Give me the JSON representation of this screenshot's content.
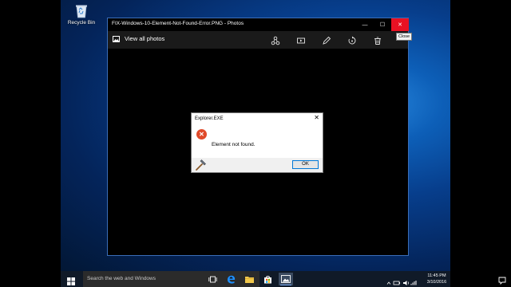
{
  "desktop": {
    "icon_label": "Recycle Bin"
  },
  "photos": {
    "title": "FIX-Windows-10-Element-Not-Found-Error.PNG - Photos",
    "minimize": "—",
    "maximize": "☐",
    "close": "✕",
    "close_tooltip": "Close",
    "view_all": "View all photos"
  },
  "dialog": {
    "title": "Explorer.EXE",
    "close": "✕",
    "error_glyph": "✕",
    "message": "Element not found.",
    "ok": "OK"
  },
  "taskbar": {
    "search_placeholder": "Search the web and Windows",
    "time": "11:45 PM",
    "date": "3/10/2016"
  },
  "colors": {
    "accent": "#0078d7",
    "close_red": "#e81123",
    "error_red": "#e04a2a"
  },
  "icons": [
    "recycle-bin-icon",
    "photo-icon",
    "share-icon",
    "slideshow-icon",
    "edit-icon",
    "rotate-icon",
    "delete-icon",
    "error-icon",
    "hammer-icon",
    "windows-icon",
    "task-view-icon",
    "edge-icon",
    "file-explorer-icon",
    "store-icon",
    "photos-icon",
    "notification-icon"
  ]
}
